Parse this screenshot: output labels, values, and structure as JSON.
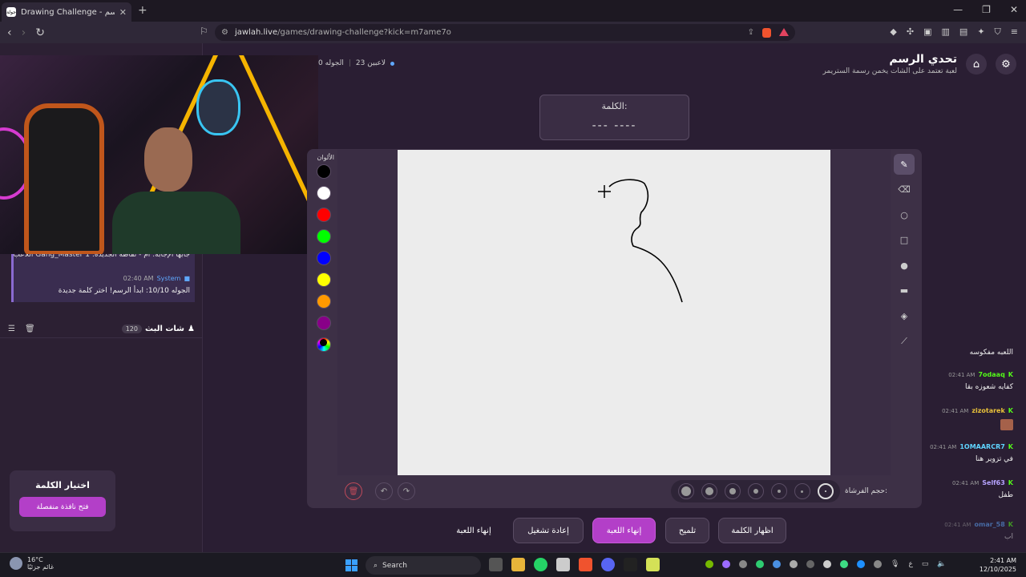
{
  "browser": {
    "tab_title": "Drawing Challenge - تحدي الرسم",
    "tab_favicon_text": "جولة",
    "url_site": "jawlah.live",
    "url_path": "/games/drawing-challenge?kick=m7ame7o"
  },
  "header": {
    "title": "تحدي الرسم",
    "subtitle": "لعبة تعتمد على الشات يخمن رسمة الستريمر",
    "players": "23 لاعبين",
    "round": "الجوله 0"
  },
  "system_message": {
    "line1": "اللاعب Gang_Master جابها الإجابة: ام - نقاطه الجديدة: 1",
    "sender": "System",
    "time": "02:40 AM",
    "line2": "الجوله 10/10: ابدأ الرسم! اختر كلمة جديدة"
  },
  "chat": {
    "title": "شات البث",
    "count": "120",
    "messages": [
      {
        "user": "",
        "time": "",
        "text": "اللعبه مفكوسه",
        "color": "#ffffff"
      },
      {
        "user": "7odaaq",
        "time": "02:41 AM",
        "text": "كفايه شعوزه بقا",
        "color": "#53fc18"
      },
      {
        "user": "zizotarek",
        "time": "02:41 AM",
        "text": "",
        "color": "#e8c13a"
      },
      {
        "user": "1OMAARCR7",
        "time": "02:41 AM",
        "text": "في تزوير هنا",
        "color": "#5fd4ff"
      },
      {
        "user": "Self63",
        "time": "02:41 AM",
        "text": "طفل",
        "color": "#b6a3ff"
      },
      {
        "user": "omar_58",
        "time": "02:41 AM",
        "text": "اب",
        "color": "#5fa8ff"
      }
    ]
  },
  "word_picker": {
    "title": "اختيار الكلمة",
    "button": "فتح نافذة منفصلة"
  },
  "word_card": {
    "label": "الكلمة:",
    "blanks": "---  ----"
  },
  "palette": {
    "label": "الألوان",
    "colors": [
      "#000000",
      "#ffffff",
      "#ff0000",
      "#00ff00",
      "#0000ff",
      "#ffff00",
      "#ff9900",
      "#880088"
    ]
  },
  "tools": [
    "pen-icon",
    "eraser-icon",
    "circle-icon",
    "rectangle-icon",
    "filled-circle-icon",
    "filled-rectangle-icon",
    "fill-bucket-icon",
    "line-icon"
  ],
  "brush": {
    "label": "حجم الفرشاة:",
    "sizes": 7,
    "selected_index": 6
  },
  "actions": {
    "show_word": "اظهار الكلمة",
    "hint": "تلميح",
    "end_game": "إنهاء اللعبة",
    "restart": "إعادة تشغيل",
    "end_game_plain": "إنهاء اللعبة"
  },
  "taskbar": {
    "temp": "16°C",
    "weather": "غائم جزئيًا",
    "search": "Search",
    "time": "2:41 AM",
    "date": "12/10/2025",
    "lang": "ع"
  }
}
